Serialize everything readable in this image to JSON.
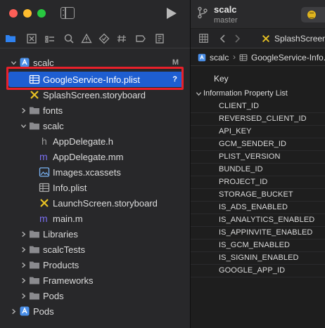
{
  "window": {
    "scheme_name": "scalc",
    "branch": "master"
  },
  "editor_tab": {
    "label": "SplashScreen."
  },
  "jumpbar": {
    "project": "scalc",
    "separator": "›",
    "file": "GoogleService-Info."
  },
  "plist": {
    "key_header": "Key",
    "root_label": "Information Property List",
    "keys": [
      "CLIENT_ID",
      "REVERSED_CLIENT_ID",
      "API_KEY",
      "GCM_SENDER_ID",
      "PLIST_VERSION",
      "BUNDLE_ID",
      "PROJECT_ID",
      "STORAGE_BUCKET",
      "IS_ADS_ENABLED",
      "IS_ANALYTICS_ENABLED",
      "IS_APPINVITE_ENABLED",
      "IS_GCM_ENABLED",
      "IS_SIGNIN_ENABLED",
      "GOOGLE_APP_ID"
    ]
  },
  "navigator": {
    "items": [
      {
        "label": "scalc",
        "badge": "M",
        "icon": "project-icon",
        "expanded": true
      },
      {
        "label": "GoogleService-Info.plist",
        "badge": "?",
        "icon": "plist-icon",
        "selected": true
      },
      {
        "label": "SplashScreen.storyboard",
        "icon": "storyboard-icon"
      },
      {
        "label": "fonts",
        "icon": "folder-icon",
        "expanded": false
      },
      {
        "label": "scalc",
        "icon": "folder-icon",
        "expanded": true
      },
      {
        "label": "AppDelegate.h",
        "icon": "header-file-icon"
      },
      {
        "label": "AppDelegate.mm",
        "icon": "objc-file-icon"
      },
      {
        "label": "Images.xcassets",
        "icon": "assets-icon"
      },
      {
        "label": "Info.plist",
        "icon": "plist-icon"
      },
      {
        "label": "LaunchScreen.storyboard",
        "icon": "storyboard-icon"
      },
      {
        "label": "main.m",
        "icon": "objc-file-icon"
      },
      {
        "label": "Libraries",
        "icon": "folder-icon",
        "expanded": false
      },
      {
        "label": "scalcTests",
        "icon": "folder-icon",
        "expanded": false
      },
      {
        "label": "Products",
        "icon": "folder-icon",
        "expanded": false
      },
      {
        "label": "Frameworks",
        "icon": "folder-icon",
        "expanded": false
      },
      {
        "label": "Pods",
        "icon": "folder-icon",
        "expanded": false
      },
      {
        "label": "Pods",
        "icon": "project-icon",
        "expanded": false
      }
    ]
  },
  "colors": {
    "selection": "#1e5ed1",
    "annotation_box": "#e8202a",
    "folder": "#8a8a8e",
    "project": "#4a8fe8",
    "storyboard": "#e8c224"
  }
}
